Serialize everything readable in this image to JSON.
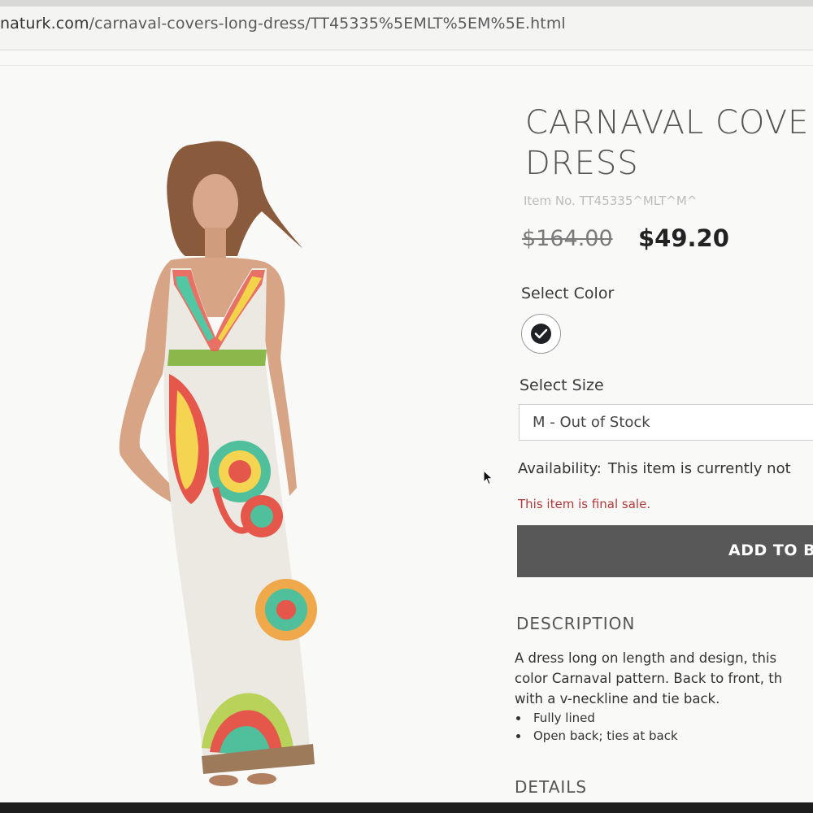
{
  "browser": {
    "url_host": "naturk.com",
    "url_path": "/carnaval-covers-long-dress/TT45335%5EMLT%5EM%5E.html"
  },
  "product": {
    "title_line1": "CARNAVAL COVE",
    "title_line2": "DRESS",
    "item_no": "Item No. TT45335^MLT^M^",
    "original_price": "$164.00",
    "sale_price": "$49.20",
    "select_color_label": "Select Color",
    "swatch_color": "#1f2126",
    "select_size_label": "Select Size",
    "size_value": "M - Out of Stock",
    "availability_label": "Availability:",
    "availability_value": "This item is currently not",
    "final_sale": "This item is final sale.",
    "add_button_label": "ADD TO BA",
    "description_title": "DESCRIPTION",
    "description_lines": [
      "A dress long on length and design, this",
      "color Carnaval pattern. Back to front, th",
      "with a v-neckline and tie back."
    ],
    "bullets": [
      "Fully lined",
      "Open back; ties at back"
    ],
    "details_title": "DETAILS"
  },
  "colors": {
    "accent_sale": "#b23a3a",
    "button_bg": "#585858"
  },
  "icons": {
    "swatch_check": "checkmark-icon",
    "cursor": "mouse-pointer-icon"
  }
}
